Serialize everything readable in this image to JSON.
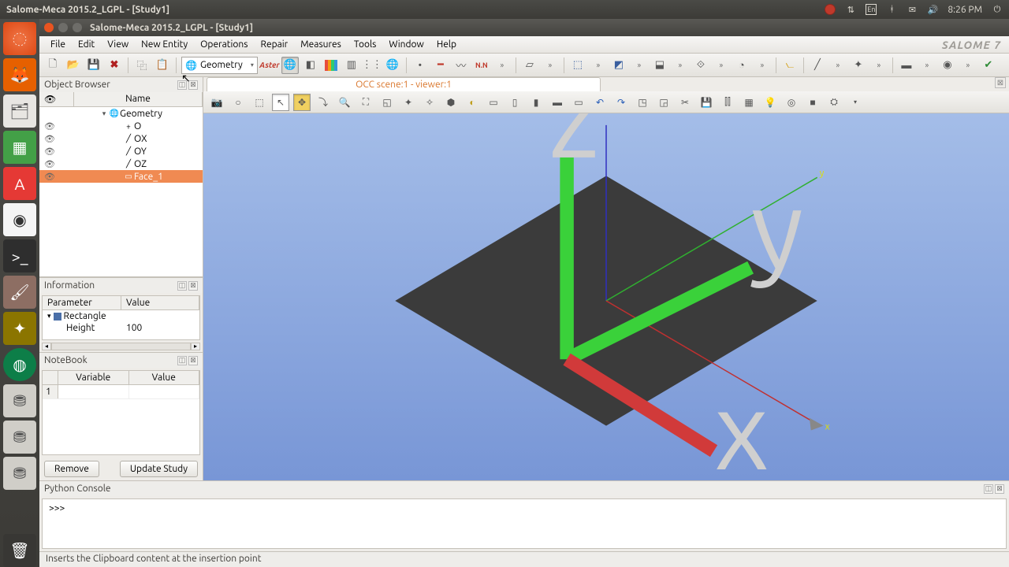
{
  "panel": {
    "title": "Salome-Meca 2015.2_LGPL - [Study1]",
    "time": "8:26 PM",
    "lang": "En"
  },
  "window": {
    "title": "Salome-Meca 2015.2_LGPL - [Study1]"
  },
  "menu": {
    "file": "File",
    "edit": "Edit",
    "view": "View",
    "new_entity": "New Entity",
    "operations": "Operations",
    "repair": "Repair",
    "measures": "Measures",
    "tools": "Tools",
    "window": "Window",
    "help": "Help",
    "brand": "SALOME 7"
  },
  "toolbar": {
    "module": "Geometry",
    "aster": "Aster"
  },
  "object_browser": {
    "title": "Object Browser",
    "col_name": "Name",
    "root": "Geometry",
    "items": [
      "O",
      "OX",
      "OY",
      "OZ",
      "Face_1"
    ]
  },
  "information": {
    "title": "Information",
    "col_param": "Parameter",
    "col_value": "Value",
    "rows": [
      {
        "param": "Rectangle",
        "value": ""
      },
      {
        "param": "Height",
        "value": "100"
      }
    ]
  },
  "notebook": {
    "title": "NoteBook",
    "col_var": "Variable",
    "col_val": "Value",
    "row_idx": "1",
    "btn_remove": "Remove",
    "btn_update": "Update Study"
  },
  "viewer": {
    "tab": "OCC scene:1 - viewer:1",
    "ylabel": "y",
    "xlabel": "x",
    "zlabel": "z"
  },
  "console": {
    "title": "Python Console",
    "prompt": ">>>"
  },
  "status": {
    "text": "Inserts the Clipboard content at the insertion point"
  }
}
